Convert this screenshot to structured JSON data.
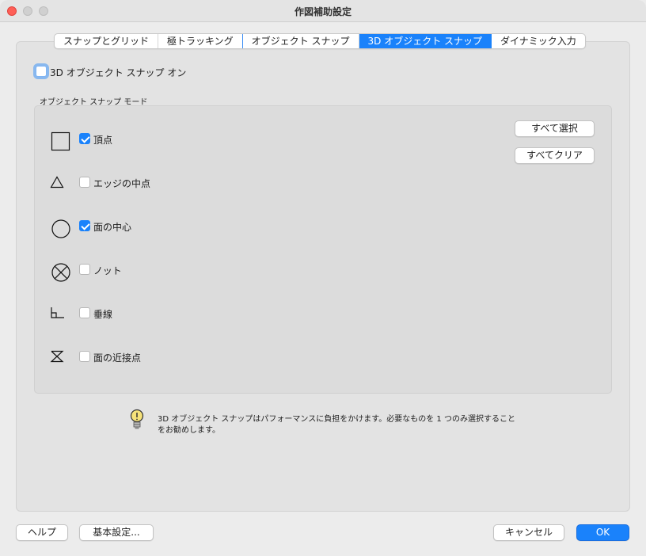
{
  "window": {
    "title": "作図補助設定"
  },
  "tabs": [
    {
      "label": "スナップとグリッド",
      "active": false
    },
    {
      "label": "極トラッキング",
      "active": false
    },
    {
      "label": "オブジェクト スナップ",
      "active": false
    },
    {
      "label": "3D オブジェクト スナップ",
      "active": true
    },
    {
      "label": "ダイナミック入力",
      "active": false
    }
  ],
  "snap_on": {
    "label": "3D オブジェクト スナップ オン",
    "checked": false
  },
  "mode_group": {
    "title": "オブジェクト スナップ モード"
  },
  "modes": [
    {
      "label": "頂点",
      "checked": true,
      "icon": "square-icon"
    },
    {
      "label": "エッジの中点",
      "checked": false,
      "icon": "triangle-icon"
    },
    {
      "label": "面の中心",
      "checked": true,
      "icon": "circle-icon"
    },
    {
      "label": "ノット",
      "checked": false,
      "icon": "circle-x-icon"
    },
    {
      "label": "垂線",
      "checked": false,
      "icon": "perpendicular-icon"
    },
    {
      "label": "面の近接点",
      "checked": false,
      "icon": "hourglass-icon"
    }
  ],
  "buttons": {
    "select_all": "すべて選択",
    "clear_all": "すべてクリア",
    "help": "ヘルプ",
    "basic_settings": "基本設定...",
    "cancel": "キャンセル",
    "ok": "OK"
  },
  "hint": {
    "text": "3D オブジェクト スナップはパフォーマンスに負担をかけます。必要なものを 1 つのみ選択することをお勧めします。",
    "icon": "lightbulb-icon"
  },
  "colors": {
    "accent": "#1a82fb",
    "close": "#fe5f57"
  }
}
